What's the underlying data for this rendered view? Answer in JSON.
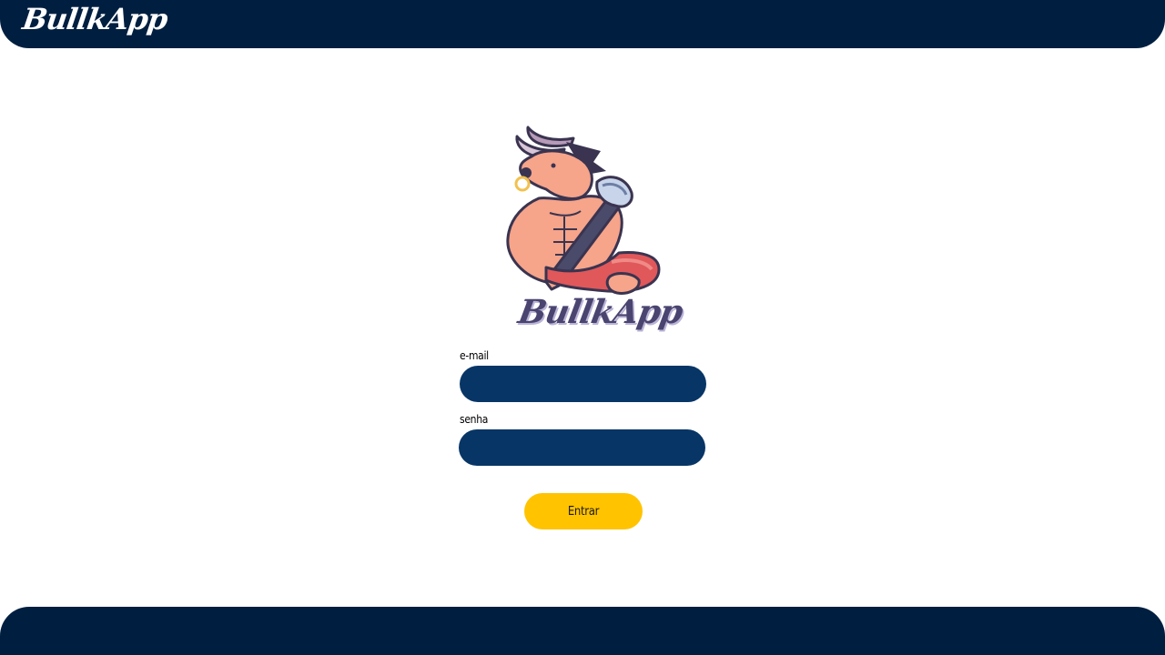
{
  "header": {
    "brand": "BullkApp",
    "background_color": "#001f40"
  },
  "login": {
    "logo_text": "BullkApp",
    "mascot": "bull-warrior-mascot",
    "email": {
      "label": "e-mail",
      "value": "",
      "placeholder": ""
    },
    "password": {
      "label": "senha",
      "value": "",
      "placeholder": ""
    },
    "submit_label": "Entrar",
    "input_color": "#073566",
    "button_color": "#ffc300"
  },
  "footer": {
    "background_color": "#001f40"
  }
}
